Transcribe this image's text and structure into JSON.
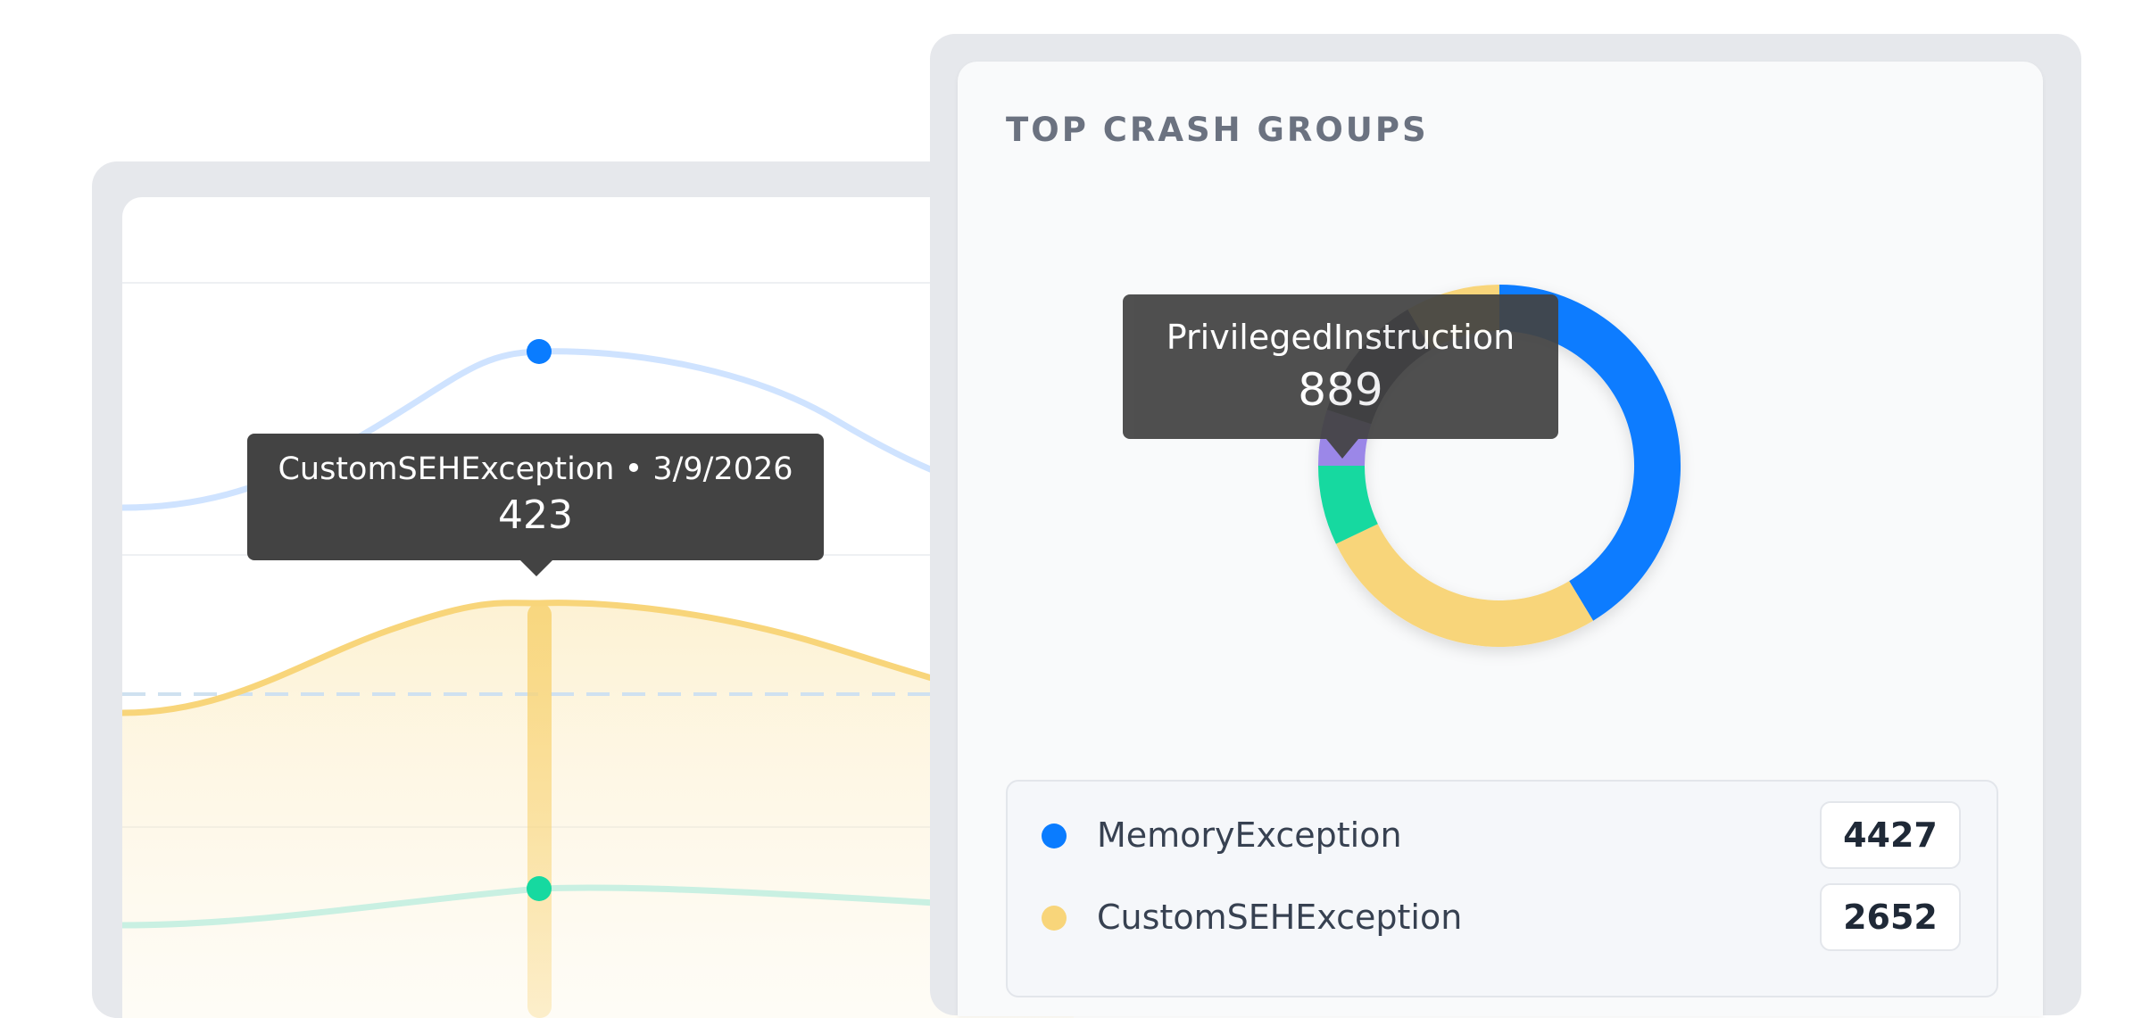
{
  "colors": {
    "MemoryException": "#0a7cff",
    "CustomSEHException": "#f8d57a",
    "green_series": "#16d9a0",
    "PrivilegedInstruction": "#9b87e8",
    "dark_segment": "#1f2540"
  },
  "line_chart": {
    "tooltip": {
      "title": "CustomSEHException • 3/9/2026",
      "value": "423"
    }
  },
  "crash_groups": {
    "title": "TOP CRASH GROUPS",
    "tooltip": {
      "title": "PrivilegedInstruction",
      "value": "889"
    },
    "legend": [
      {
        "label": "MemoryException",
        "count": "4427",
        "color": "#0a7cff"
      },
      {
        "label": "CustomSEHException",
        "count": "2652",
        "color": "#f8d57a"
      }
    ]
  }
}
